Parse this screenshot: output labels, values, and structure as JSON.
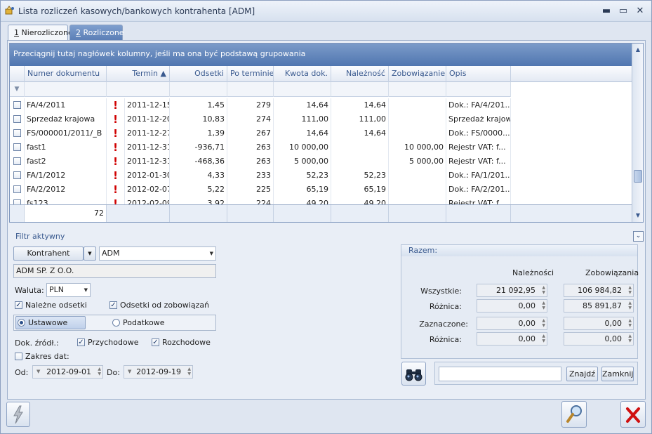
{
  "window": {
    "title": "Lista rozliczeń kasowych/bankowych kontrahenta [ADM]"
  },
  "tabs": [
    {
      "key": "1",
      "label": " Nierozliczone"
    },
    {
      "key": "2",
      "label": " Rozliczone"
    }
  ],
  "grid": {
    "group_hint": "Przeciągnij tutaj nagłówek kolumny, jeśli ma ona być podstawą grupowania",
    "columns": [
      "Numer dokumentu",
      "Termin ▲",
      "Odsetki",
      "Po terminie",
      "Kwota dok.",
      "Należność",
      "Zobowiązanie",
      "Opis"
    ],
    "rows": [
      {
        "num": "FA/4/2011",
        "termin": "2011-12-15",
        "odsetki": "1,45",
        "po_terminie": "279",
        "kwota": "14,64",
        "naleznosc": "14,64",
        "zobowiazanie": "",
        "opis": "Dok.: FA/4/201..."
      },
      {
        "num": "Sprzedaż krajowa",
        "termin": "2011-12-20",
        "odsetki": "10,83",
        "po_terminie": "274",
        "kwota": "111,00",
        "naleznosc": "111,00",
        "zobowiazanie": "",
        "opis": "Sprzedaż krajowa"
      },
      {
        "num": "FS/000001/2011/_B",
        "termin": "2011-12-27",
        "odsetki": "1,39",
        "po_terminie": "267",
        "kwota": "14,64",
        "naleznosc": "14,64",
        "zobowiazanie": "",
        "opis": "Dok.: FS/0000..."
      },
      {
        "num": "fast1",
        "termin": "2011-12-31",
        "odsetki": "-936,71",
        "po_terminie": "263",
        "kwota": "10 000,00",
        "naleznosc": "",
        "zobowiazanie": "10 000,00",
        "opis": "Rejestr VAT: f..."
      },
      {
        "num": "fast2",
        "termin": "2011-12-31",
        "odsetki": "-468,36",
        "po_terminie": "263",
        "kwota": "5 000,00",
        "naleznosc": "",
        "zobowiazanie": "5 000,00",
        "opis": "Rejestr VAT: f..."
      },
      {
        "num": "FA/1/2012",
        "termin": "2012-01-30",
        "odsetki": "4,33",
        "po_terminie": "233",
        "kwota": "52,23",
        "naleznosc": "52,23",
        "zobowiazanie": "",
        "opis": "Dok.: FA/1/201..."
      },
      {
        "num": "FA/2/2012",
        "termin": "2012-02-07",
        "odsetki": "5,22",
        "po_terminie": "225",
        "kwota": "65,19",
        "naleznosc": "65,19",
        "zobowiazanie": "",
        "opis": "Dok.: FA/2/201..."
      },
      {
        "num": "fs123",
        "termin": "2012-02-09",
        "odsetki": "3,92",
        "po_terminie": "224",
        "kwota": "49,20",
        "naleznosc": "49,20",
        "zobowiazanie": "",
        "opis": "Rejestr VAT: f..."
      }
    ],
    "footer_count": "72"
  },
  "filter": {
    "title": "Filtr aktywny",
    "kontrahent_button": "Kontrahent",
    "kontrahent_value": "ADM",
    "kontrahent_name": "ADM SP. Z O.O.",
    "waluta_label": "Waluta:",
    "waluta_value": "PLN",
    "nalezne_odsetki": "Należne odsetki",
    "odsetki_zobowiazan": "Odsetki od zobowiązań",
    "ustawowe": "Ustawowe",
    "podatkowe": "Podatkowe",
    "dok_zrodl": "Dok. źródł.:",
    "przychodowe": "Przychodowe",
    "rozchodowe": "Rozchodowe",
    "zakres_dat": "Zakres dat:",
    "od_label": "Od:",
    "od_value": "2012-09-01",
    "do_label": "Do:",
    "do_value": "2012-09-19"
  },
  "razem": {
    "title": "Razem:",
    "col_naleznosci": "Należności",
    "col_zobowiazania": "Zobowiązania",
    "wszystkie_label": "Wszystkie:",
    "wszystkie_n": "21 092,95",
    "wszystkie_z": "106 984,82",
    "roznica1_label": "Różnica:",
    "roznica1_n": "0,00",
    "roznica1_z": "85 891,87",
    "zaznaczone_label": "Zaznaczone:",
    "zaznaczone_n": "0,00",
    "zaznaczone_z": "0,00",
    "roznica2_label": "Różnica:",
    "roznica2_n": "0,00",
    "roznica2_z": "0,00"
  },
  "search": {
    "find_label": "Znajdź",
    "close_label": "Zamknij",
    "value": ""
  },
  "colors": {
    "accent": "#5b7fb6",
    "exclamation": "#d00000",
    "close_red": "#d01010"
  }
}
